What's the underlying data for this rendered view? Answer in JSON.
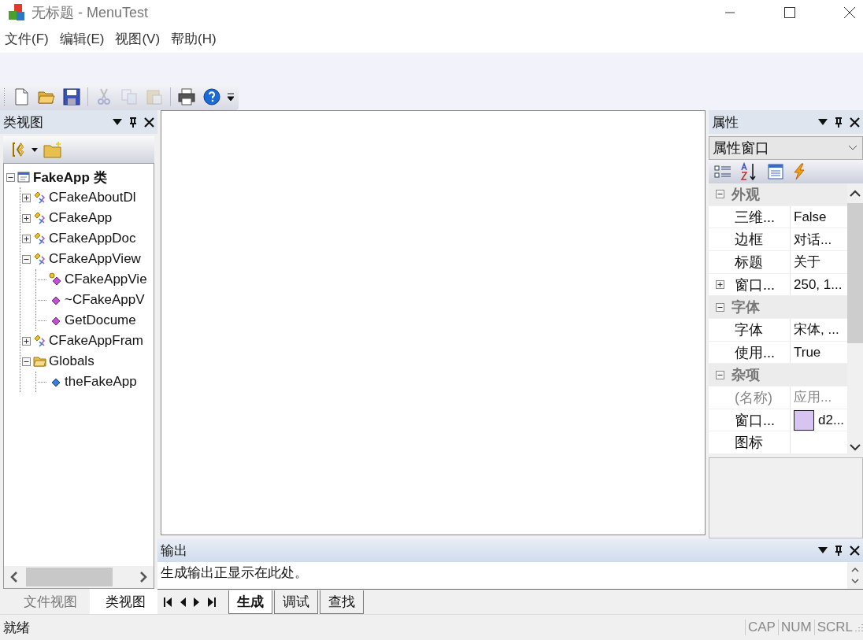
{
  "window": {
    "title": "无标题 - MenuTest"
  },
  "menu": [
    "文件(F)",
    "编辑(E)",
    "视图(V)",
    "帮助(H)"
  ],
  "toolbar": [
    {
      "kind": "new",
      "disabled": false
    },
    {
      "kind": "open",
      "disabled": false
    },
    {
      "kind": "save",
      "disabled": false
    },
    {
      "kind": "sep"
    },
    {
      "kind": "cut",
      "disabled": true
    },
    {
      "kind": "copy",
      "disabled": true
    },
    {
      "kind": "paste",
      "disabled": true
    },
    {
      "kind": "sep"
    },
    {
      "kind": "print",
      "disabled": false
    },
    {
      "kind": "help",
      "disabled": false
    }
  ],
  "class_view": {
    "title": "类视图",
    "tree": [
      {
        "label": "FakeApp 类",
        "kind": "root",
        "expanded": true,
        "children": [
          {
            "label": "CFakeAboutDl",
            "kind": "class",
            "expanded": false
          },
          {
            "label": "CFakeApp",
            "kind": "class",
            "expanded": false
          },
          {
            "label": "CFakeAppDoc",
            "kind": "class",
            "expanded": false
          },
          {
            "label": "CFakeAppView",
            "kind": "class",
            "expanded": true,
            "children": [
              {
                "label": "CFakeAppVie",
                "kind": "protected-method"
              },
              {
                "label": "~CFakeAppV",
                "kind": "method"
              },
              {
                "label": "GetDocume",
                "kind": "method"
              }
            ]
          },
          {
            "label": "CFakeAppFram",
            "kind": "class",
            "expanded": false
          },
          {
            "label": "Globals",
            "kind": "folder",
            "expanded": true,
            "children": [
              {
                "label": "theFakeApp",
                "kind": "variable"
              }
            ]
          }
        ]
      }
    ],
    "tabs": [
      {
        "label": "文件视图",
        "selected": false
      },
      {
        "label": "类视图",
        "selected": true
      }
    ]
  },
  "properties": {
    "title": "属性",
    "combo": "属性窗口",
    "categories": [
      {
        "name": "外观",
        "expanded": true,
        "rows": [
          {
            "name": "三维...",
            "value": "False",
            "kind": "text",
            "disabled": false
          },
          {
            "name": "边框",
            "value": "对话...",
            "kind": "text",
            "disabled": false
          },
          {
            "name": "标题",
            "value": "关于",
            "kind": "text",
            "disabled": false
          },
          {
            "name": "窗口...",
            "value": "250, 1...",
            "kind": "group",
            "expanded": false,
            "disabled": false
          }
        ]
      },
      {
        "name": "字体",
        "expanded": true,
        "rows": [
          {
            "name": "字体",
            "value": "宋体, ...",
            "kind": "text",
            "disabled": false
          },
          {
            "name": "使用...",
            "value": "True",
            "kind": "text",
            "disabled": false
          }
        ]
      },
      {
        "name": "杂项",
        "expanded": true,
        "rows": [
          {
            "name": "(名称)",
            "value": "应用...",
            "kind": "text",
            "disabled": true
          },
          {
            "name": "窗口...",
            "value": "d2...",
            "kind": "color",
            "color": "#d8c4f0",
            "disabled": false
          },
          {
            "name": "图标",
            "kind": "text",
            "disabled": false
          }
        ]
      }
    ]
  },
  "output": {
    "title": "输出",
    "lines": [
      "生成输出正显示在此处。"
    ],
    "tabs": [
      {
        "label": "生成",
        "selected": true
      },
      {
        "label": "调试",
        "selected": false
      },
      {
        "label": "查找",
        "selected": false
      }
    ]
  },
  "status_bar": {
    "text": "就绪",
    "indicators": [
      "CAP",
      "NUM",
      "SCRL"
    ]
  }
}
